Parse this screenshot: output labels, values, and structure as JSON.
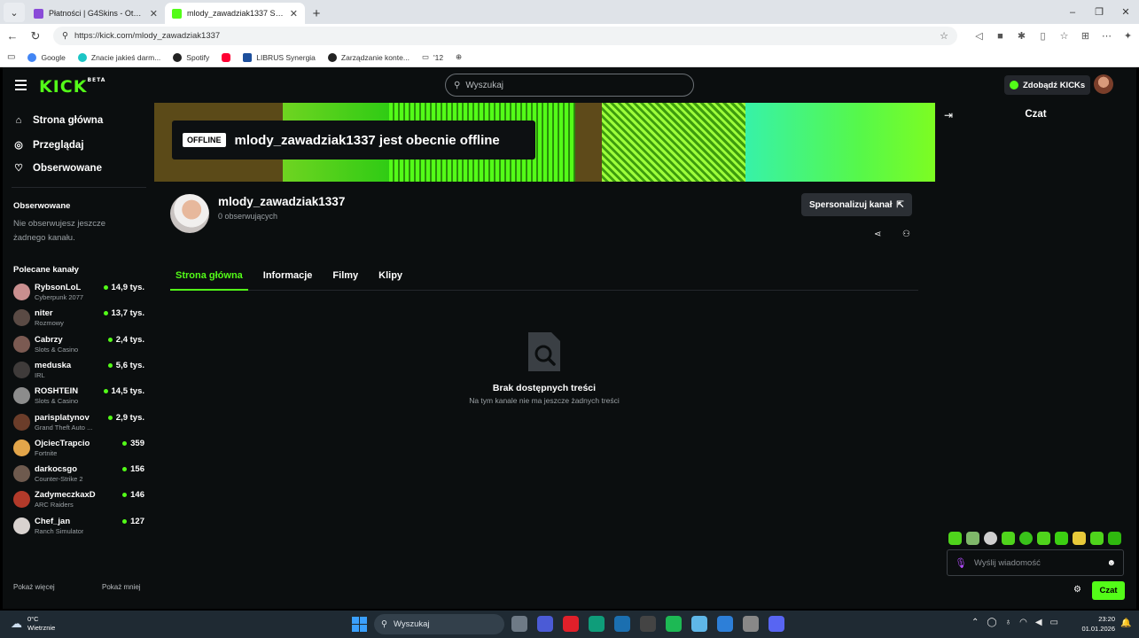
{
  "browser": {
    "tabs": [
      {
        "title": "Płatności | G4Skins - Otwieraj skrz",
        "favicon_color": "#8a4bd8",
        "active": false
      },
      {
        "title": "mlody_zawadziak1337 Stream - W",
        "favicon_color": "#53fc18",
        "active": true
      }
    ],
    "new_tab_icon": "+",
    "window_controls": [
      "–",
      "❐",
      "✕"
    ],
    "url": "https://kick.com/mlody_zawadziak1337",
    "bookmarks": [
      {
        "label": "Google",
        "color": "#4285f4"
      },
      {
        "label": "Znacie jakieś darm...",
        "color": "#1bc5c5"
      },
      {
        "label": "Spotify",
        "color": "#222222"
      },
      {
        "label": "",
        "color": "#ff0033"
      },
      {
        "label": "LIBRUS Synergia",
        "color": "#1d4f9c"
      },
      {
        "label": "Zarządzanie konte...",
        "color": "#222222"
      },
      {
        "label": "'12",
        "color": "#888888"
      },
      {
        "label": "",
        "color": "#666666"
      }
    ]
  },
  "header": {
    "logo": "KICK",
    "logo_tm": "BETA",
    "search_placeholder": "Wyszukaj",
    "get_kicks_label": "Zdobądź KICKs"
  },
  "sidebar": {
    "nav": [
      {
        "label": "Strona główna",
        "icon": "home-icon",
        "glyph": "⌂"
      },
      {
        "label": "Przeglądaj",
        "icon": "compass-icon",
        "glyph": "◎"
      },
      {
        "label": "Obserwowane",
        "icon": "heart-icon",
        "glyph": "♡"
      }
    ],
    "following_title": "Obserwowane",
    "following_empty": "Nie obserwujesz jeszcze żadnego kanału.",
    "recommended_title": "Polecane kanały",
    "channels": [
      {
        "name": "RybsonLoL",
        "category": "Cyberpunk 2077",
        "viewers": "14,9 tys.",
        "avatar_color": "#c98f8f"
      },
      {
        "name": "niter",
        "category": "Rozmowy",
        "viewers": "13,7 tys.",
        "avatar_color": "#5a4a44"
      },
      {
        "name": "Cabrzy",
        "category": "Slots & Casino",
        "viewers": "2,4 tys.",
        "avatar_color": "#7b5a52"
      },
      {
        "name": "meduska",
        "category": "IRL",
        "viewers": "5,6 tys.",
        "avatar_color": "#3f3b3a"
      },
      {
        "name": "ROSHTEIN",
        "category": "Slots & Casino",
        "viewers": "14,5 tys.",
        "avatar_color": "#8c8c8c"
      },
      {
        "name": "parisplatynov",
        "category": "Grand Theft Auto ...",
        "viewers": "2,9 tys.",
        "avatar_color": "#6b3d2a"
      },
      {
        "name": "OjciecTrapcio",
        "category": "Fortnite",
        "viewers": "359",
        "avatar_color": "#e3a54a"
      },
      {
        "name": "darkocsgo",
        "category": "Counter-Strike 2",
        "viewers": "156",
        "avatar_color": "#6e5a4e"
      },
      {
        "name": "ZadymeczkaxD",
        "category": "ARC Raiders",
        "viewers": "146",
        "avatar_color": "#b23a2a"
      },
      {
        "name": "Chef_jan",
        "category": "Ranch Simulator",
        "viewers": "127",
        "avatar_color": "#d8d2cf"
      }
    ],
    "show_more": "Pokaż więcej",
    "show_less": "Pokaż mniej"
  },
  "banner": {
    "offline_tag": "OFFLINE",
    "offline_text": "mlody_zawadziak1337 jest obecnie offline"
  },
  "channel": {
    "name": "mlody_zawadziak1337",
    "followers": "0 obserwujących",
    "customize_label": "Spersonalizuj kanał",
    "tabs": [
      "Strona główna",
      "Informacje",
      "Filmy",
      "Klipy"
    ],
    "empty_title": "Brak dostępnych treści",
    "empty_subtitle": "Na tym kanale nie ma jeszcze żadnych treści"
  },
  "chat": {
    "title": "Czat",
    "input_placeholder": "Wyślij wiadomość",
    "send_label": "Czat"
  },
  "taskbar": {
    "temperature": "0°C",
    "weather": "Wietrznie",
    "search_label": "Wyszukaj",
    "apps": [
      "#6e7a86",
      "#4b5bd6",
      "#e0202a",
      "#0f9d7a",
      "#1b6fb0",
      "#444444",
      "#1db954",
      "#5fb7e8",
      "#2d7fd8",
      "#888888",
      "#5865f2"
    ],
    "time": "23:20",
    "date": "01.01.2026"
  },
  "colors": {
    "accent": "#53fc18",
    "background": "#0b0e0f"
  }
}
